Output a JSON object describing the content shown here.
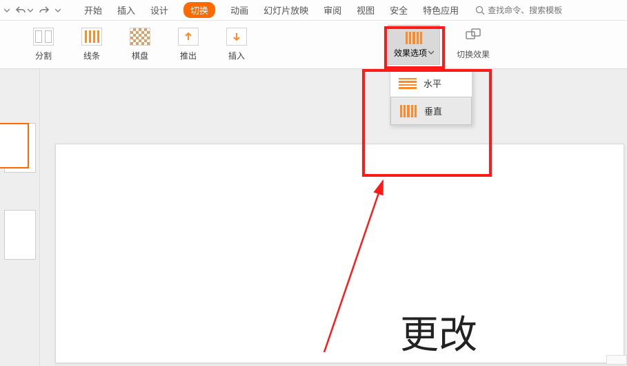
{
  "qat": {
    "undo_tooltip": "撤销",
    "redo_tooltip": "重做"
  },
  "menus": {
    "start": "开始",
    "insert": "插入",
    "design": "设计",
    "transition": "切换",
    "animation": "动画",
    "slideshow": "幻灯片放映",
    "review": "审阅",
    "view": "视图",
    "security": "安全",
    "special": "特色应用"
  },
  "search": {
    "placeholder": "查找命令、搜索模板"
  },
  "ribbon": {
    "split": "分割",
    "lines": "线条",
    "checker": "棋盘",
    "push": "推出",
    "insert_trans": "插入",
    "effect_options": "效果选项",
    "switch_effect": "切换效果"
  },
  "dropdown": {
    "horizontal": "水平",
    "vertical": "垂直"
  },
  "annotation_text": "更改",
  "colors": {
    "accent": "#ff6a00",
    "highlight": "#ff1a1a"
  }
}
